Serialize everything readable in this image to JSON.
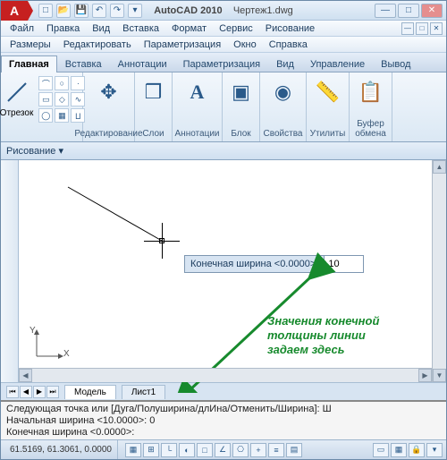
{
  "titlebar": {
    "app": "AutoCAD 2010",
    "doc": "Чертеж1.dwg",
    "logo_letter": "A"
  },
  "qat": {
    "new": "□",
    "open": "📂",
    "save": "💾",
    "undo": "↶",
    "redo": "↷",
    "more": "▾"
  },
  "win": {
    "min": "—",
    "max": "□",
    "close": "✕"
  },
  "menubar1": {
    "file": "Файл",
    "edit": "Правка",
    "view": "Вид",
    "insert": "Вставка",
    "format": "Формат",
    "service": "Сервис",
    "draw": "Рисование"
  },
  "menubar2": {
    "dims": "Размеры",
    "modify": "Редактировать",
    "param": "Параметризация",
    "window": "Окно",
    "help": "Справка"
  },
  "ribbon_tabs": {
    "home": "Главная",
    "insert": "Вставка",
    "annotate": "Аннотации",
    "param": "Параметризация",
    "view": "Вид",
    "manage": "Управление",
    "output": "Вывод"
  },
  "ribbon": {
    "line_label": "Отрезок",
    "modify_label": "Редактирование",
    "layers_label": "Слои",
    "annot_label": "Аннотации",
    "block_label": "Блок",
    "props_label": "Свойства",
    "utils_label": "Утилиты",
    "clip_label": "Буфер обмена",
    "annot_glyph": "A"
  },
  "ribbon_lower": {
    "panel": "Рисование",
    "chevron": "▾"
  },
  "prompt": {
    "label": "Конечная ширина <0.0000>:",
    "value": "10"
  },
  "annotation": {
    "l1": "Значения конечной",
    "l2": "толщины линии",
    "l3": "задаем здесь"
  },
  "ucs": {
    "x": "X",
    "y": "Y"
  },
  "model_tabs": {
    "model": "Модель",
    "sheet1": "Лист1",
    "nav_first": "⏮",
    "nav_prev": "◀",
    "nav_next": "▶",
    "nav_last": "⏭"
  },
  "cmd": {
    "l1": "Следующая точка или [Дуга/Полуширина/длИна/Отменить/Ширина]: Ш",
    "l2": "Начальная ширина <10.0000>: 0",
    "l3": "Конечная ширина <0.0000>:"
  },
  "status": {
    "coords": "61.5169, 61.3061, 0.0000"
  }
}
